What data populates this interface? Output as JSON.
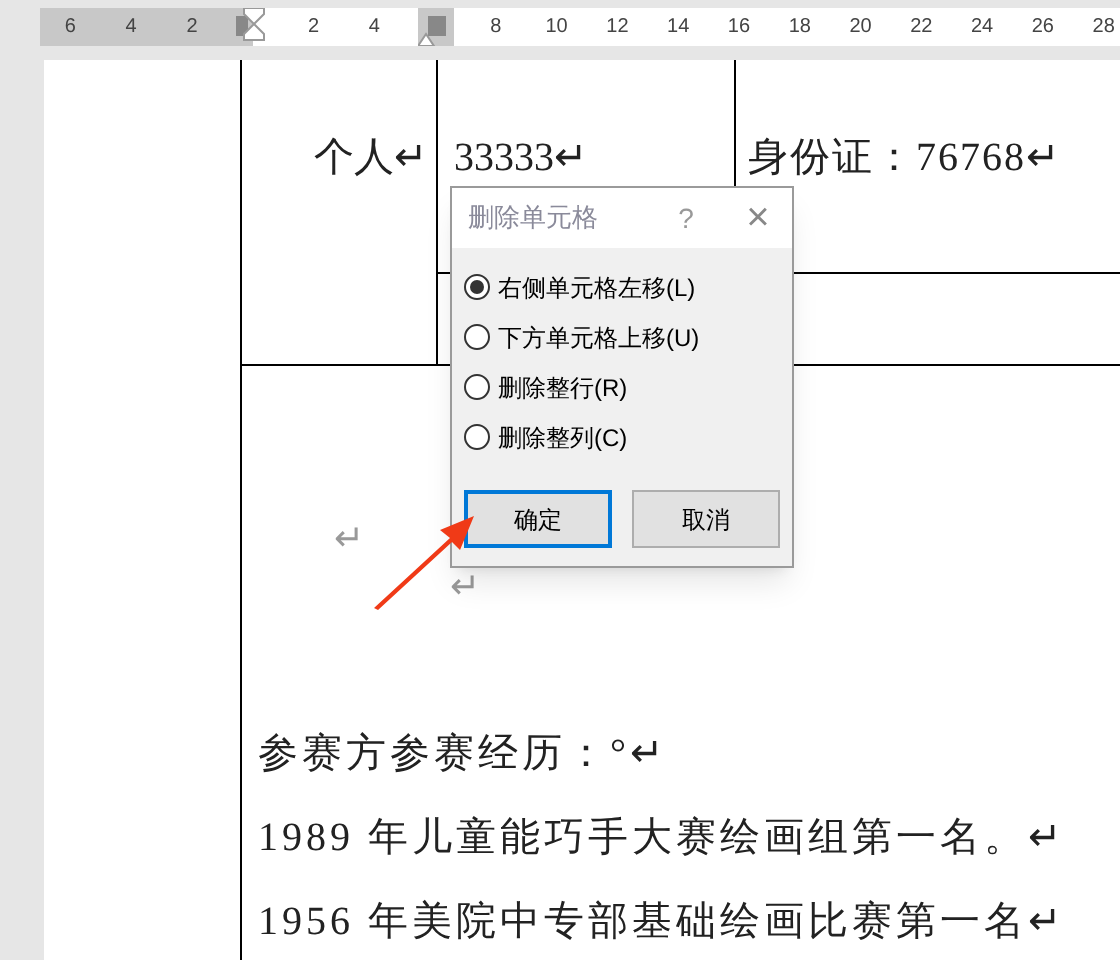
{
  "ruler": [
    {
      "kind": "number",
      "label": "6",
      "margin": true
    },
    {
      "kind": "number",
      "label": "4",
      "margin": true
    },
    {
      "kind": "number",
      "label": "2",
      "margin": true
    },
    {
      "kind": "indent-marker"
    },
    {
      "kind": "number",
      "label": "2",
      "margin": false
    },
    {
      "kind": "number",
      "label": "4",
      "margin": false
    },
    {
      "kind": "column-marker"
    },
    {
      "kind": "number",
      "label": "8",
      "margin": false
    },
    {
      "kind": "number",
      "label": "10",
      "margin": false
    },
    {
      "kind": "number",
      "label": "12",
      "margin": false
    },
    {
      "kind": "number",
      "label": "14",
      "margin": false
    },
    {
      "kind": "number",
      "label": "16",
      "margin": false
    },
    {
      "kind": "number",
      "label": "18",
      "margin": false
    },
    {
      "kind": "number",
      "label": "20",
      "margin": false
    },
    {
      "kind": "number",
      "label": "22",
      "margin": false
    },
    {
      "kind": "number",
      "label": "24",
      "margin": false
    },
    {
      "kind": "number",
      "label": "26",
      "margin": false
    },
    {
      "kind": "number",
      "label": "28",
      "margin": false
    }
  ],
  "table": {
    "row_1": {
      "column_1": "个人↵",
      "column_2": "33333↵",
      "column_3": "身份证：76768↵"
    },
    "row_2": {
      "marks": [
        "↵",
        "↵"
      ],
      "paragraphs": [
        "参赛方参赛经历：°↵",
        "1989 年儿童能巧手大赛绘画组第一名。↵",
        "1956 年美院中专部基础绘画比赛第一名↵"
      ]
    }
  },
  "dialog": {
    "title": "删除单元格",
    "help": "?",
    "close": "×",
    "options": [
      {
        "label": "右侧单元格左移(L)",
        "selected": true
      },
      {
        "label": "下方单元格上移(U)",
        "selected": false
      },
      {
        "label": "删除整行(R)",
        "selected": false
      },
      {
        "label": "删除整列(C)",
        "selected": false
      }
    ],
    "buttons": [
      {
        "label": "确定",
        "default": true
      },
      {
        "label": "取消",
        "default": false
      }
    ]
  }
}
